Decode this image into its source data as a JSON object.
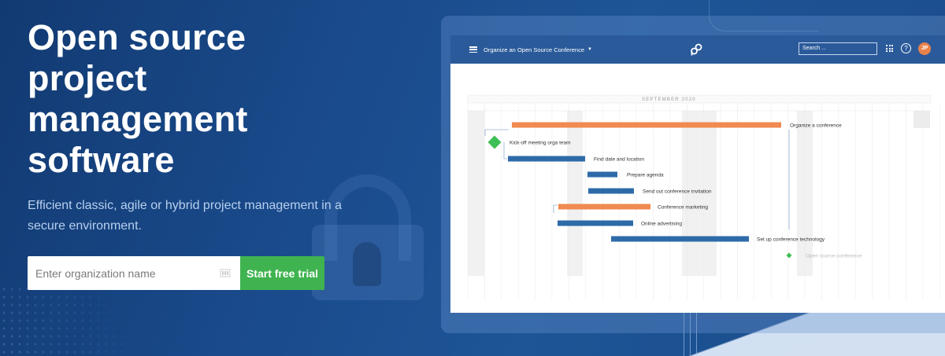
{
  "hero": {
    "title": "Open source project management software",
    "subtitle": "Efficient classic, agile or hybrid project management in a secure environment."
  },
  "signup": {
    "placeholder": "Enter organization name",
    "button_label": "Start free trial"
  },
  "app": {
    "project_name": "Organize an Open Source Conference",
    "search_placeholder": "Search ...",
    "help_label": "?",
    "avatar_initials": "JP",
    "colors": {
      "header": "#2a5a9a",
      "bar": "#2e6aa8",
      "milestone": "#3ebf55",
      "summary": "#f08a50"
    },
    "gantt": {
      "month_label": "SEPTEMBER 2020",
      "tasks": [
        {
          "label": "Organize a conference",
          "type": "summary"
        },
        {
          "label": "Kick-off meeting orga team",
          "type": "milestone"
        },
        {
          "label": "Find date and location",
          "type": "task"
        },
        {
          "label": "Prepare agenda",
          "type": "task"
        },
        {
          "label": "Send out conference invitation",
          "type": "task"
        },
        {
          "label": "Conference marketing",
          "type": "summary"
        },
        {
          "label": "Online advertising",
          "type": "task"
        },
        {
          "label": "Set up conference technology",
          "type": "task"
        },
        {
          "label": "Open source conference",
          "type": "milestone",
          "muted": true
        }
      ]
    }
  }
}
